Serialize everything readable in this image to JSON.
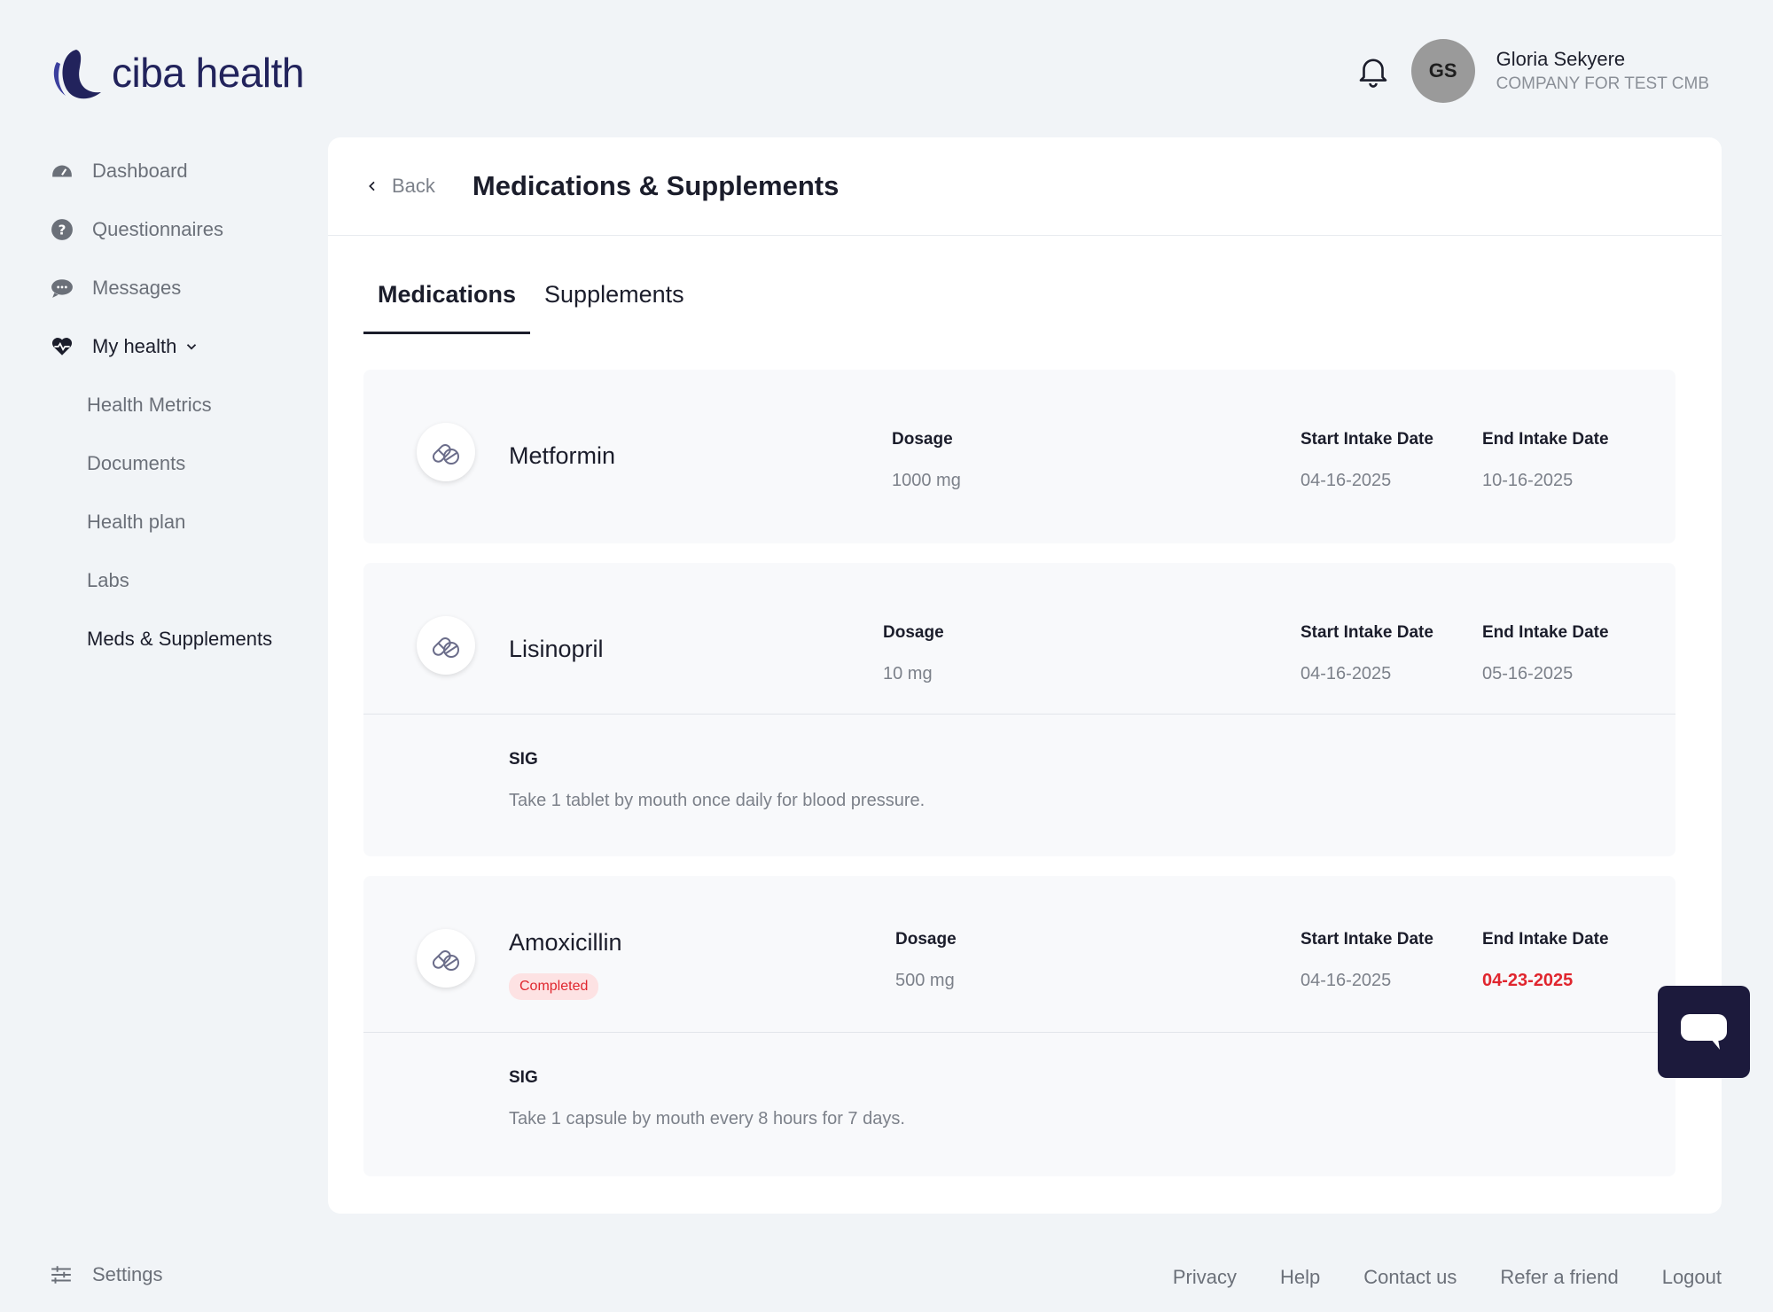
{
  "brand": {
    "name": "ciba health",
    "accent": "#22235c"
  },
  "user": {
    "initials": "GS",
    "name": "Gloria Sekyere",
    "company": "COMPANY FOR TEST CMB"
  },
  "sidebar": {
    "items": [
      {
        "label": "Dashboard",
        "icon": "dashboard-icon"
      },
      {
        "label": "Questionnaires",
        "icon": "question-icon"
      },
      {
        "label": "Messages",
        "icon": "chat-icon"
      },
      {
        "label": "My health",
        "icon": "heart-pulse-icon"
      }
    ],
    "subitems": [
      "Health Metrics",
      "Documents",
      "Health plan",
      "Labs",
      "Meds & Supplements"
    ]
  },
  "page": {
    "back_label": "Back",
    "title": "Medications & Supplements"
  },
  "tabs": [
    "Medications",
    "Supplements"
  ],
  "labels": {
    "dosage": "Dosage",
    "start": "Start Intake Date",
    "end": "End Intake Date",
    "sig": "SIG"
  },
  "medications": [
    {
      "name": "Metformin",
      "dosage": "1000 mg",
      "start": "04-16-2025",
      "end": "10-16-2025"
    },
    {
      "name": "Lisinopril",
      "dosage": "10 mg",
      "start": "04-16-2025",
      "end": "05-16-2025",
      "sig": "Take 1 tablet by mouth once daily for blood pressure."
    },
    {
      "name": "Amoxicillin",
      "status": "Completed",
      "dosage": "500 mg",
      "start": "04-16-2025",
      "end": "04-23-2025",
      "sig": "Take 1 capsule by mouth every 8 hours for 7 days."
    }
  ],
  "footer": {
    "settings": "Settings",
    "links": [
      "Privacy",
      "Help",
      "Contact us",
      "Refer a friend",
      "Logout"
    ]
  }
}
